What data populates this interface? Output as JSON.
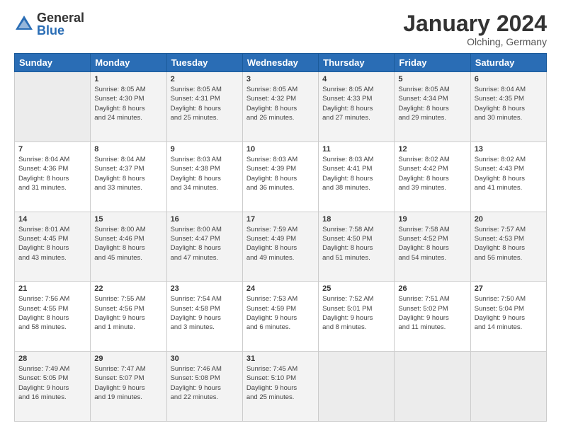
{
  "logo": {
    "general": "General",
    "blue": "Blue"
  },
  "title": "January 2024",
  "location": "Olching, Germany",
  "weekdays": [
    "Sunday",
    "Monday",
    "Tuesday",
    "Wednesday",
    "Thursday",
    "Friday",
    "Saturday"
  ],
  "weeks": [
    [
      {
        "day": "",
        "info": ""
      },
      {
        "day": "1",
        "info": "Sunrise: 8:05 AM\nSunset: 4:30 PM\nDaylight: 8 hours\nand 24 minutes."
      },
      {
        "day": "2",
        "info": "Sunrise: 8:05 AM\nSunset: 4:31 PM\nDaylight: 8 hours\nand 25 minutes."
      },
      {
        "day": "3",
        "info": "Sunrise: 8:05 AM\nSunset: 4:32 PM\nDaylight: 8 hours\nand 26 minutes."
      },
      {
        "day": "4",
        "info": "Sunrise: 8:05 AM\nSunset: 4:33 PM\nDaylight: 8 hours\nand 27 minutes."
      },
      {
        "day": "5",
        "info": "Sunrise: 8:05 AM\nSunset: 4:34 PM\nDaylight: 8 hours\nand 29 minutes."
      },
      {
        "day": "6",
        "info": "Sunrise: 8:04 AM\nSunset: 4:35 PM\nDaylight: 8 hours\nand 30 minutes."
      }
    ],
    [
      {
        "day": "7",
        "info": "Sunrise: 8:04 AM\nSunset: 4:36 PM\nDaylight: 8 hours\nand 31 minutes."
      },
      {
        "day": "8",
        "info": "Sunrise: 8:04 AM\nSunset: 4:37 PM\nDaylight: 8 hours\nand 33 minutes."
      },
      {
        "day": "9",
        "info": "Sunrise: 8:03 AM\nSunset: 4:38 PM\nDaylight: 8 hours\nand 34 minutes."
      },
      {
        "day": "10",
        "info": "Sunrise: 8:03 AM\nSunset: 4:39 PM\nDaylight: 8 hours\nand 36 minutes."
      },
      {
        "day": "11",
        "info": "Sunrise: 8:03 AM\nSunset: 4:41 PM\nDaylight: 8 hours\nand 38 minutes."
      },
      {
        "day": "12",
        "info": "Sunrise: 8:02 AM\nSunset: 4:42 PM\nDaylight: 8 hours\nand 39 minutes."
      },
      {
        "day": "13",
        "info": "Sunrise: 8:02 AM\nSunset: 4:43 PM\nDaylight: 8 hours\nand 41 minutes."
      }
    ],
    [
      {
        "day": "14",
        "info": "Sunrise: 8:01 AM\nSunset: 4:45 PM\nDaylight: 8 hours\nand 43 minutes."
      },
      {
        "day": "15",
        "info": "Sunrise: 8:00 AM\nSunset: 4:46 PM\nDaylight: 8 hours\nand 45 minutes."
      },
      {
        "day": "16",
        "info": "Sunrise: 8:00 AM\nSunset: 4:47 PM\nDaylight: 8 hours\nand 47 minutes."
      },
      {
        "day": "17",
        "info": "Sunrise: 7:59 AM\nSunset: 4:49 PM\nDaylight: 8 hours\nand 49 minutes."
      },
      {
        "day": "18",
        "info": "Sunrise: 7:58 AM\nSunset: 4:50 PM\nDaylight: 8 hours\nand 51 minutes."
      },
      {
        "day": "19",
        "info": "Sunrise: 7:58 AM\nSunset: 4:52 PM\nDaylight: 8 hours\nand 54 minutes."
      },
      {
        "day": "20",
        "info": "Sunrise: 7:57 AM\nSunset: 4:53 PM\nDaylight: 8 hours\nand 56 minutes."
      }
    ],
    [
      {
        "day": "21",
        "info": "Sunrise: 7:56 AM\nSunset: 4:55 PM\nDaylight: 8 hours\nand 58 minutes."
      },
      {
        "day": "22",
        "info": "Sunrise: 7:55 AM\nSunset: 4:56 PM\nDaylight: 9 hours\nand 1 minute."
      },
      {
        "day": "23",
        "info": "Sunrise: 7:54 AM\nSunset: 4:58 PM\nDaylight: 9 hours\nand 3 minutes."
      },
      {
        "day": "24",
        "info": "Sunrise: 7:53 AM\nSunset: 4:59 PM\nDaylight: 9 hours\nand 6 minutes."
      },
      {
        "day": "25",
        "info": "Sunrise: 7:52 AM\nSunset: 5:01 PM\nDaylight: 9 hours\nand 8 minutes."
      },
      {
        "day": "26",
        "info": "Sunrise: 7:51 AM\nSunset: 5:02 PM\nDaylight: 9 hours\nand 11 minutes."
      },
      {
        "day": "27",
        "info": "Sunrise: 7:50 AM\nSunset: 5:04 PM\nDaylight: 9 hours\nand 14 minutes."
      }
    ],
    [
      {
        "day": "28",
        "info": "Sunrise: 7:49 AM\nSunset: 5:05 PM\nDaylight: 9 hours\nand 16 minutes."
      },
      {
        "day": "29",
        "info": "Sunrise: 7:47 AM\nSunset: 5:07 PM\nDaylight: 9 hours\nand 19 minutes."
      },
      {
        "day": "30",
        "info": "Sunrise: 7:46 AM\nSunset: 5:08 PM\nDaylight: 9 hours\nand 22 minutes."
      },
      {
        "day": "31",
        "info": "Sunrise: 7:45 AM\nSunset: 5:10 PM\nDaylight: 9 hours\nand 25 minutes."
      },
      {
        "day": "",
        "info": ""
      },
      {
        "day": "",
        "info": ""
      },
      {
        "day": "",
        "info": ""
      }
    ]
  ]
}
